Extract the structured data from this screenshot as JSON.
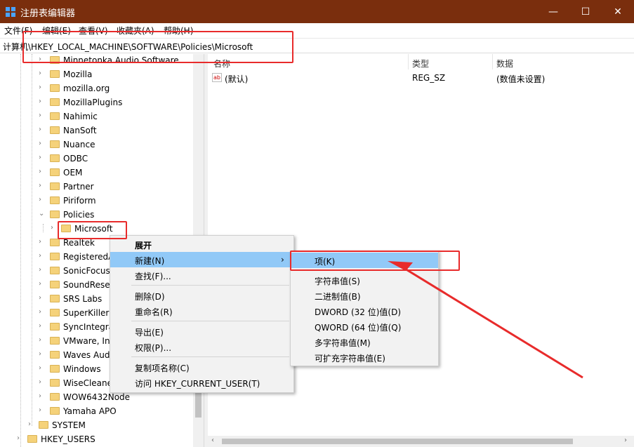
{
  "window": {
    "title": "注册表编辑器",
    "minimize_glyph": "—",
    "maximize_glyph": "☐",
    "close_glyph": "✕"
  },
  "menu": [
    "文件(F)",
    "编辑(E)",
    "查看(V)",
    "收藏夹(A)",
    "帮助(H)"
  ],
  "address": "计算机\\HKEY_LOCAL_MACHINE\\SOFTWARE\\Policies\\Microsoft",
  "tree": {
    "items": [
      {
        "label": "Minnetonka Audio Software"
      },
      {
        "label": "Mozilla"
      },
      {
        "label": "mozilla.org"
      },
      {
        "label": "MozillaPlugins"
      },
      {
        "label": "Nahimic"
      },
      {
        "label": "NanSoft"
      },
      {
        "label": "Nuance"
      },
      {
        "label": "ODBC"
      },
      {
        "label": "OEM"
      },
      {
        "label": "Partner"
      },
      {
        "label": "Piriform"
      },
      {
        "label": "Policies"
      },
      {
        "label": "Microsoft"
      },
      {
        "label": "Realtek"
      },
      {
        "label": "RegisteredA"
      },
      {
        "label": "SonicFocus"
      },
      {
        "label": "SoundResea"
      },
      {
        "label": "SRS Labs"
      },
      {
        "label": "SuperKiller"
      },
      {
        "label": "SyncIntegra"
      },
      {
        "label": "VMware, Inc"
      },
      {
        "label": "Waves Audi"
      },
      {
        "label": "Windows"
      },
      {
        "label": "WiseCleane"
      },
      {
        "label": "WOW6432Node"
      },
      {
        "label": "Yamaha APO"
      },
      {
        "label": "SYSTEM"
      },
      {
        "label": "HKEY_USERS"
      }
    ]
  },
  "values_table": {
    "columns": [
      "名称",
      "类型",
      "数据"
    ],
    "rows": [
      {
        "name": "(默认)",
        "type": "REG_SZ",
        "data": "(数值未设置)",
        "icon": "ab"
      }
    ]
  },
  "context_menu": {
    "items": [
      "展开",
      "新建(N)",
      "查找(F)...",
      "删除(D)",
      "重命名(R)",
      "导出(E)",
      "权限(P)...",
      "复制项名称(C)",
      "访问 HKEY_CURRENT_USER(T)"
    ]
  },
  "submenu": {
    "items": [
      "项(K)",
      "字符串值(S)",
      "二进制值(B)",
      "DWORD (32 位)值(D)",
      "QWORD (64 位)值(Q)",
      "多字符串值(M)",
      "可扩充字符串值(E)"
    ]
  },
  "colors": {
    "titlebar": "#7a2e0d",
    "highlight": "#91c9f7",
    "annotation_red": "#e82b2b",
    "folder": "#f5d27a"
  }
}
